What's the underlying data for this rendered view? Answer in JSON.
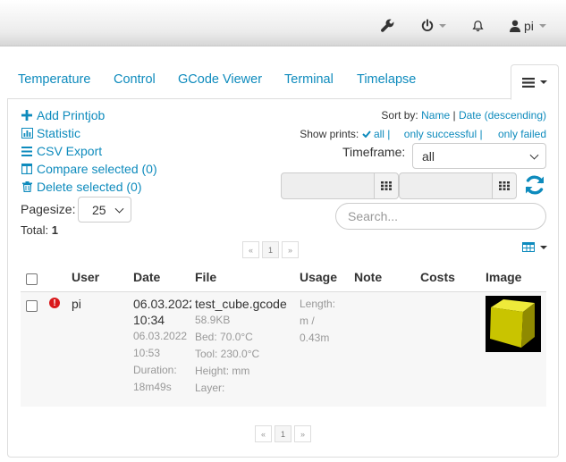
{
  "navbar": {
    "user": "pi",
    "icons": {
      "settings": "wrench-icon",
      "power": "power-icon",
      "notifications": "bell-icon",
      "user": "user-icon"
    }
  },
  "tabs": [
    {
      "label": "Temperature"
    },
    {
      "label": "Control"
    },
    {
      "label": "GCode Viewer"
    },
    {
      "label": "Terminal"
    },
    {
      "label": "Timelapse"
    }
  ],
  "actions": {
    "add": "Add Printjob",
    "statistic": "Statistic",
    "csv": "CSV Export",
    "compare": "Compare selected (0)",
    "delete": "Delete selected (0)"
  },
  "sort": {
    "label": "Sort by:",
    "name": "Name",
    "separator": "|",
    "date": "Date (descending)"
  },
  "show_prints": {
    "label": "Show prints:",
    "all": "all",
    "successful": "only successful",
    "failed": "only failed",
    "separator": "|"
  },
  "timeframe": {
    "label": "Timeframe:",
    "value": "all"
  },
  "search": {
    "placeholder": "Search..."
  },
  "pagesize": {
    "label": "Pagesize:",
    "value": "25"
  },
  "total": {
    "label": "Total:",
    "value": "1"
  },
  "pager": {
    "prev": "«",
    "page": "1",
    "next": "»"
  },
  "table": {
    "headers": {
      "user": "User",
      "date": "Date",
      "file": "File",
      "usage": "Usage",
      "note": "Note",
      "costs": "Costs",
      "image": "Image"
    },
    "row": {
      "user": "pi",
      "date": "06.03.2022",
      "time": "10:34",
      "end_date": "06.03.2022",
      "end_time": "10:53",
      "duration": "Duration:",
      "duration_value": "18m49s",
      "file": "test_cube.gcode",
      "size": "58.9KB",
      "bed": "Bed: 70.0°C",
      "tool": "Tool: 230.0°C",
      "height": "Height: mm",
      "layer": "Layer:",
      "length_label": "Length:",
      "length_unit": "m /",
      "length_value": "0.43m"
    }
  },
  "colors": {
    "accent": "#0e8bbd",
    "error": "#d9191c",
    "cube": "#d8d400"
  }
}
